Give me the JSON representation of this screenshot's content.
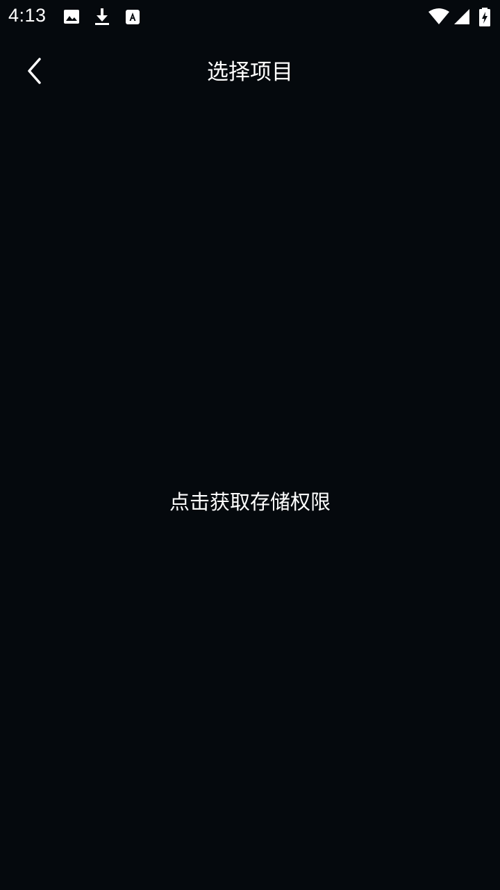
{
  "status_bar": {
    "time": "4:13",
    "notification_icons": [
      "image-icon",
      "download-icon",
      "text-a-icon"
    ],
    "system_icons": [
      "wifi-icon",
      "cell-signal-icon",
      "battery-charging-icon"
    ]
  },
  "app_bar": {
    "back_icon": "chevron-left-icon",
    "title": "选择项目"
  },
  "main": {
    "permission_prompt": "点击获取存储权限"
  },
  "colors": {
    "background": "#05090d",
    "text": "#ffffff"
  }
}
